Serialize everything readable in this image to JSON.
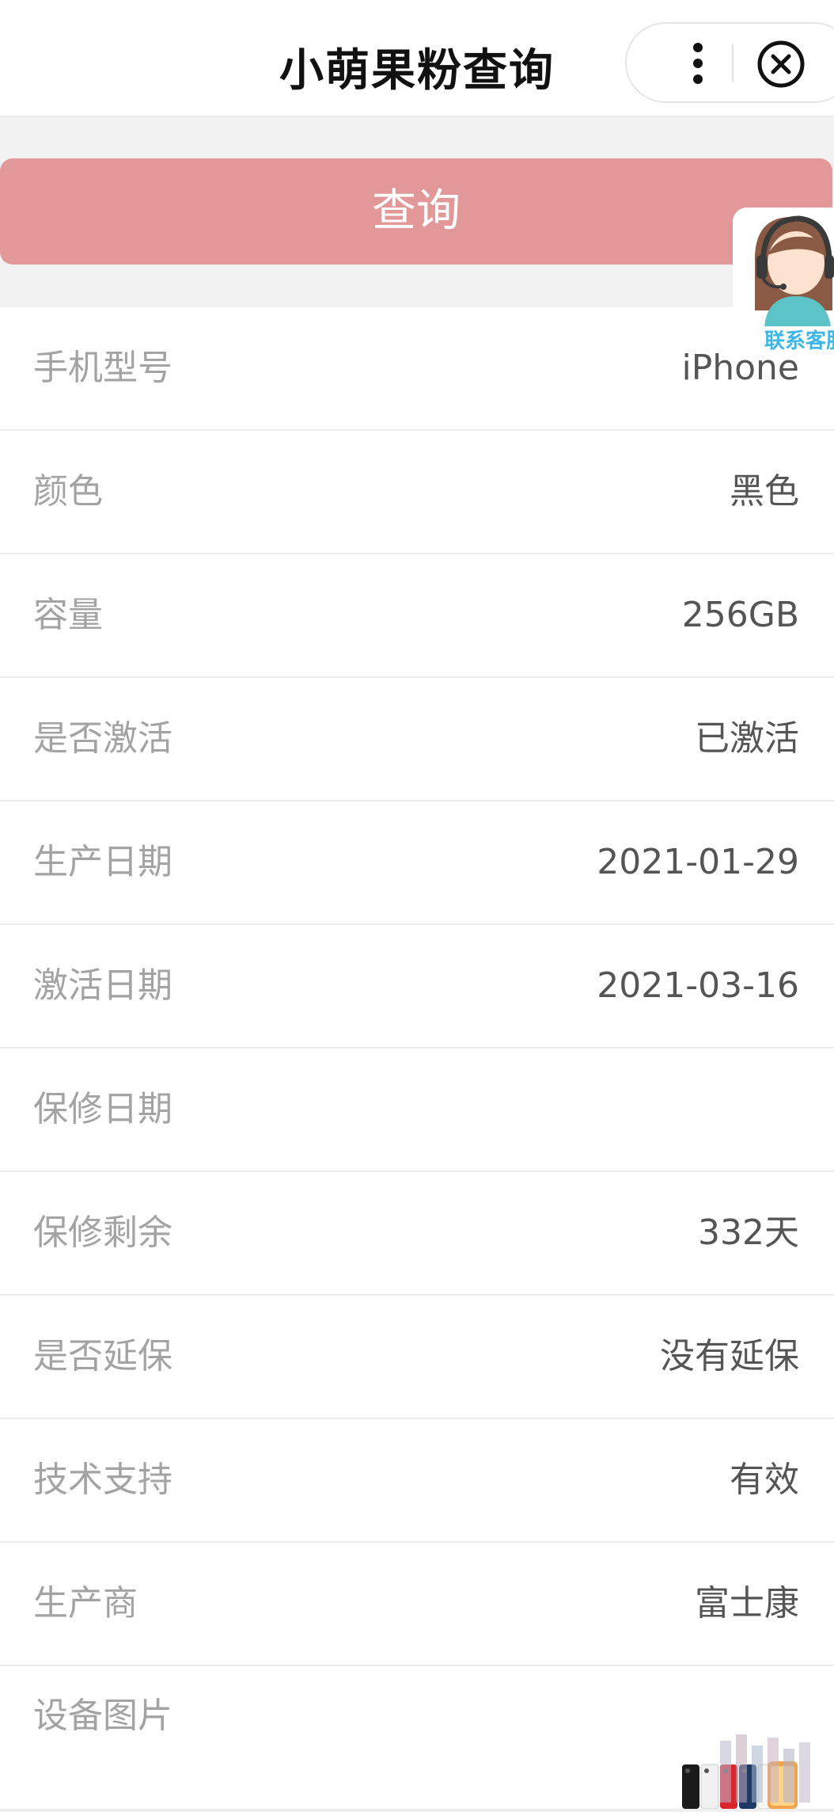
{
  "header": {
    "title": "小萌果粉查询"
  },
  "query_button": {
    "label": "查询"
  },
  "support_widget": {
    "label": "联系客服"
  },
  "device_info": {
    "rows": [
      {
        "label": "手机型号",
        "value": "iPhone"
      },
      {
        "label": "颜色",
        "value": "黑色"
      },
      {
        "label": "容量",
        "value": "256GB"
      },
      {
        "label": "是否激活",
        "value": "已激活"
      },
      {
        "label": "生产日期",
        "value": "2021-01-29"
      },
      {
        "label": "激活日期",
        "value": "2021-03-16"
      },
      {
        "label": "保修日期",
        "value": ""
      },
      {
        "label": "保修剩余",
        "value": "332天"
      },
      {
        "label": "是否延保",
        "value": "没有延保"
      },
      {
        "label": "技术支持",
        "value": "有效"
      },
      {
        "label": "生产商",
        "value": "富士康"
      },
      {
        "label": "设备图片",
        "value": ""
      }
    ]
  },
  "colors": {
    "accent_button": "#e29898",
    "support_text": "#3fb7e6"
  },
  "icons": [
    "more-vertical-icon",
    "close-circle-icon",
    "support-agent-icon",
    "device-phones-image"
  ]
}
